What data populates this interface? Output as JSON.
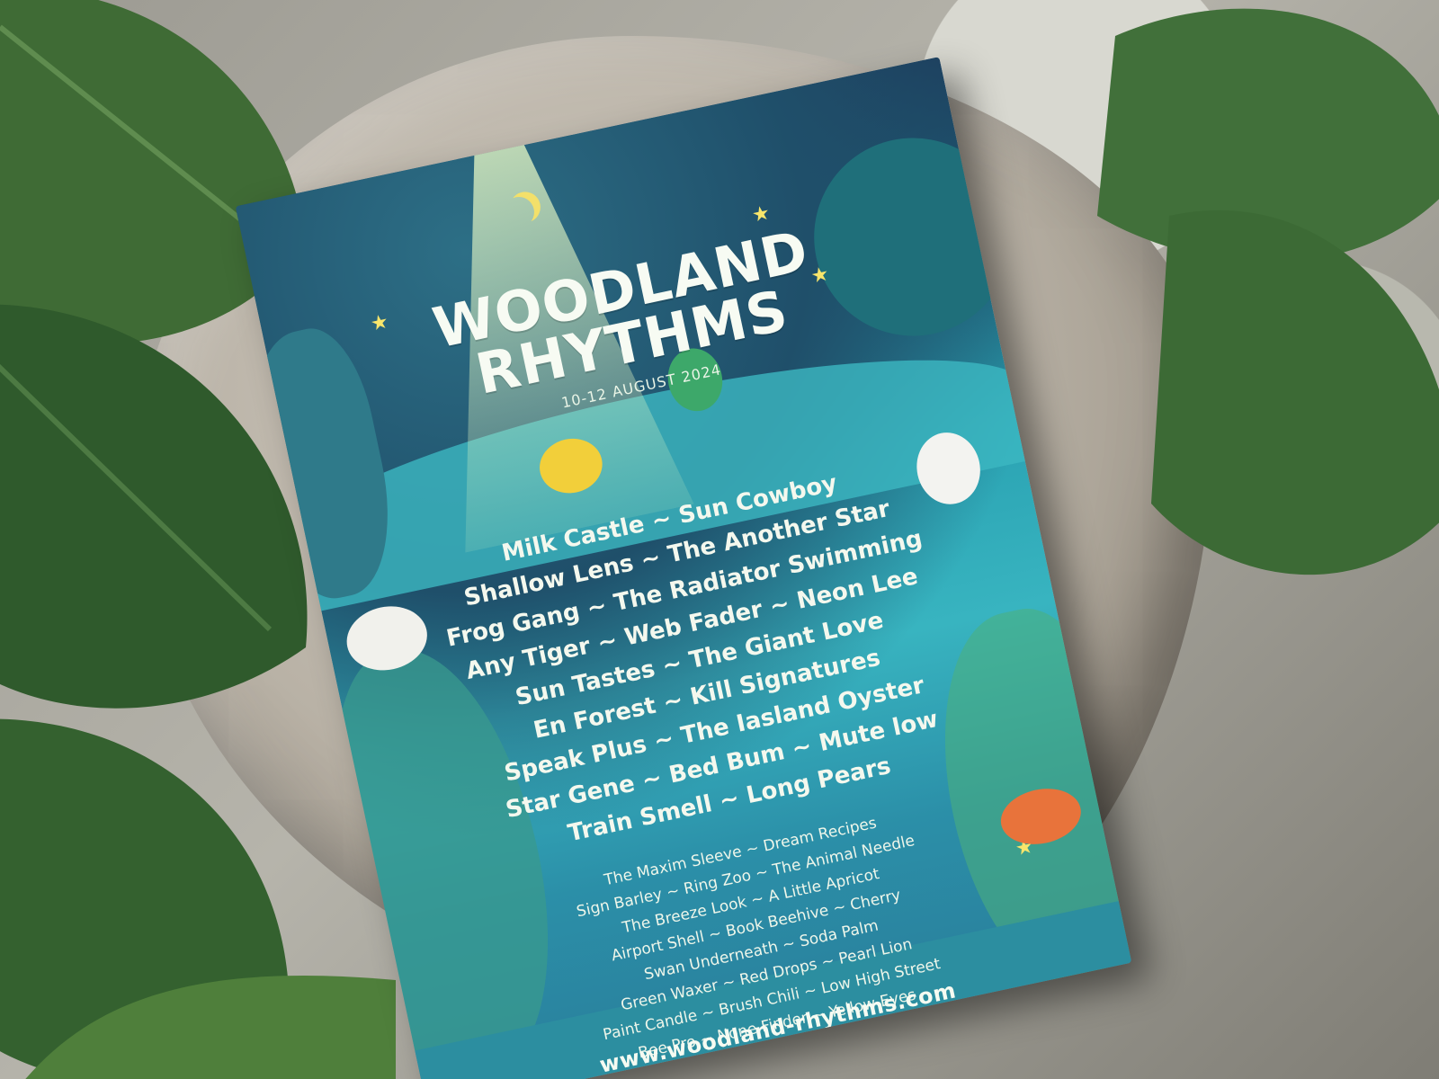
{
  "poster": {
    "title_line1": "WOODLAND",
    "title_line2": "RHYTHMS",
    "date": "10-12 AUGUST 2024",
    "headliners": [
      "Milk Castle ~ Sun Cowboy",
      "Shallow Lens ~ The Another Star",
      "Frog Gang ~ The Radiator Swimming",
      "Any Tiger ~ Web Fader ~ Neon Lee",
      "Sun Tastes ~ The Giant Love",
      "En Forest ~ Kill Signatures",
      "Speak Plus ~ The Iasland Oyster",
      "Star Gene ~ Bed Bum ~ Mute low",
      "Train Smell ~ Long Pears"
    ],
    "support_acts": [
      "The Maxim Sleeve ~ Dream Recipes",
      "Sign Barley ~ Ring Zoo ~ The Animal Needle",
      "The Breeze Look ~ A Little Apricot",
      "Airport Shell ~ Book Beehive ~ Cherry",
      "Swan Underneath ~ Soda Palm",
      "Green Waxer ~ Red Drops ~ Pearl Lion",
      "Paint Candle ~ Brush Chili ~ Low High Street",
      "Bee Pro ~ None Finder ~ Yellow Eyes"
    ],
    "url": "www.woodland-rhythms.com"
  },
  "colors": {
    "poster_sky": "#1e3c5c",
    "poster_water": "#38b4c0",
    "title_text": "#f7fbf3",
    "star_yellow": "#f8e56b",
    "rock": "#b9b2a6",
    "leaf_green": "#2f5a2c"
  }
}
